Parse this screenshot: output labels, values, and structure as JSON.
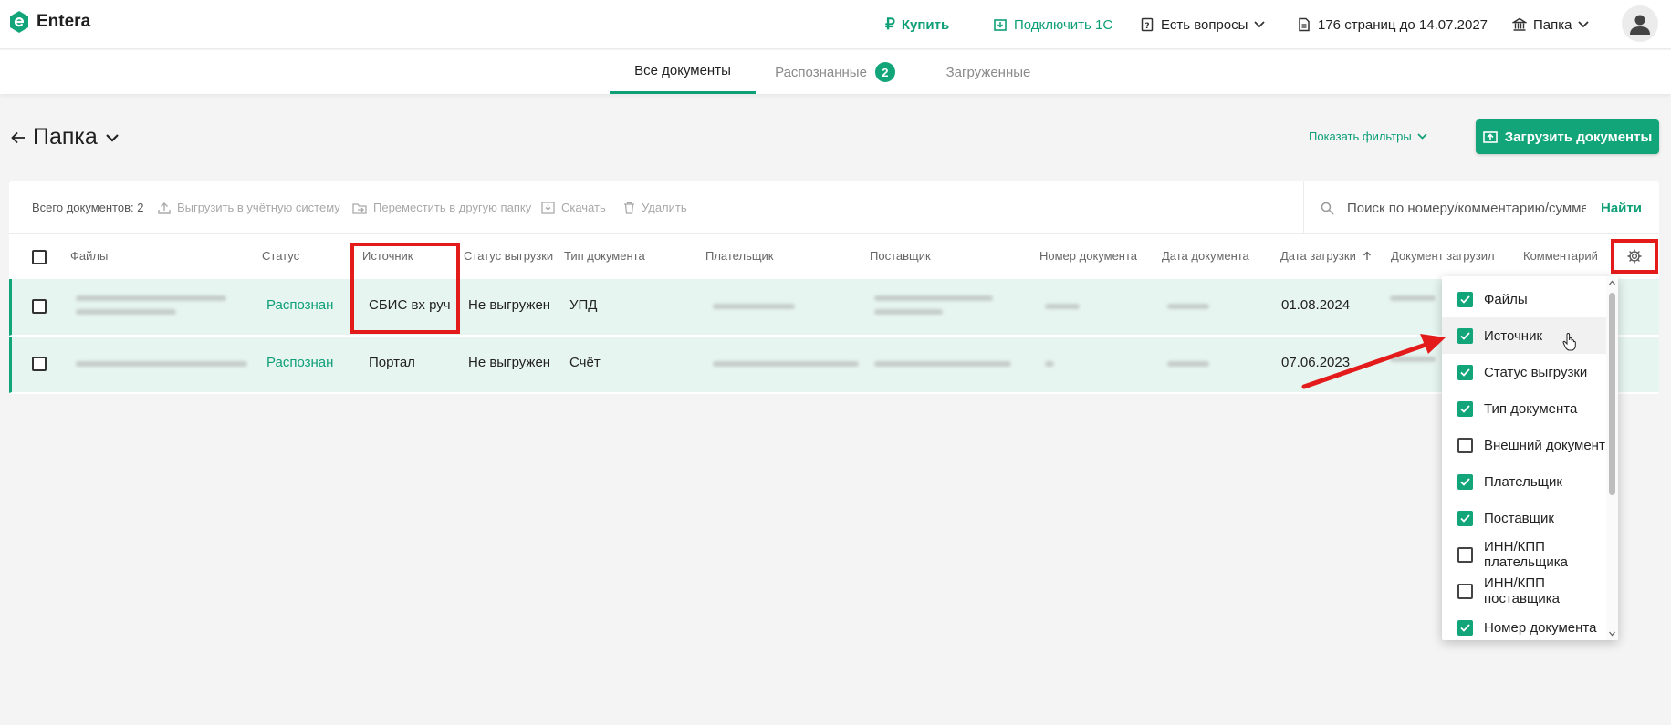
{
  "header": {
    "app_name": "Entera",
    "buy_label": "Купить",
    "connect_label": "Подключить 1С",
    "questions_label": "Есть вопросы",
    "pages_label": "176 страниц до 14.07.2027",
    "folder_menu_label": "Папка",
    "accent_color": "#12a57a"
  },
  "tabs": [
    {
      "label": "Все документы",
      "active": true
    },
    {
      "label": "Распознанные",
      "badge": "2"
    },
    {
      "label": "Загруженные"
    }
  ],
  "page": {
    "back_icon": "arrow-left-icon",
    "title": "Папка",
    "show_filters_label": "Показать фильтры",
    "upload_label": "Загрузить документы"
  },
  "toolbar": {
    "total_label": "Всего документов: 2",
    "export_label": "Выгрузить в учётную систему",
    "move_label": "Переместить в другую папку",
    "download_label": "Скачать",
    "delete_label": "Удалить",
    "search_placeholder": "Поиск по номеру/комментарию/сумме",
    "find_label": "Найти"
  },
  "table": {
    "columns": [
      "Файлы",
      "Статус",
      "Источник",
      "Статус выгрузки",
      "Тип документа",
      "Плательщик",
      "Поставщик",
      "Номер документа",
      "Дата документа",
      "Дата загрузки",
      "Документ загрузил",
      "Комментарий"
    ],
    "rows": [
      {
        "status": "Распознан",
        "source": "СБИС вх руч",
        "export_status": "Не выгружен",
        "doc_type": "УПД",
        "upload_date": "01.08.2024"
      },
      {
        "status": "Распознан",
        "source": "Портал",
        "export_status": "Не выгружен",
        "doc_type": "Счёт",
        "upload_date": "07.06.2023"
      }
    ]
  },
  "column_menu": {
    "items": [
      {
        "label": "Файлы",
        "checked": true
      },
      {
        "label": "Источник",
        "checked": true
      },
      {
        "label": "Статус выгрузки",
        "checked": true
      },
      {
        "label": "Тип документа",
        "checked": true
      },
      {
        "label": "Внешний документ",
        "checked": false
      },
      {
        "label": "Плательщик",
        "checked": true
      },
      {
        "label": "Поставщик",
        "checked": true
      },
      {
        "label": "ИНН/КПП плательщика",
        "checked": false
      },
      {
        "label": "ИНН/КПП поставщика",
        "checked": false
      },
      {
        "label": "Номер документа",
        "checked": true
      }
    ]
  }
}
